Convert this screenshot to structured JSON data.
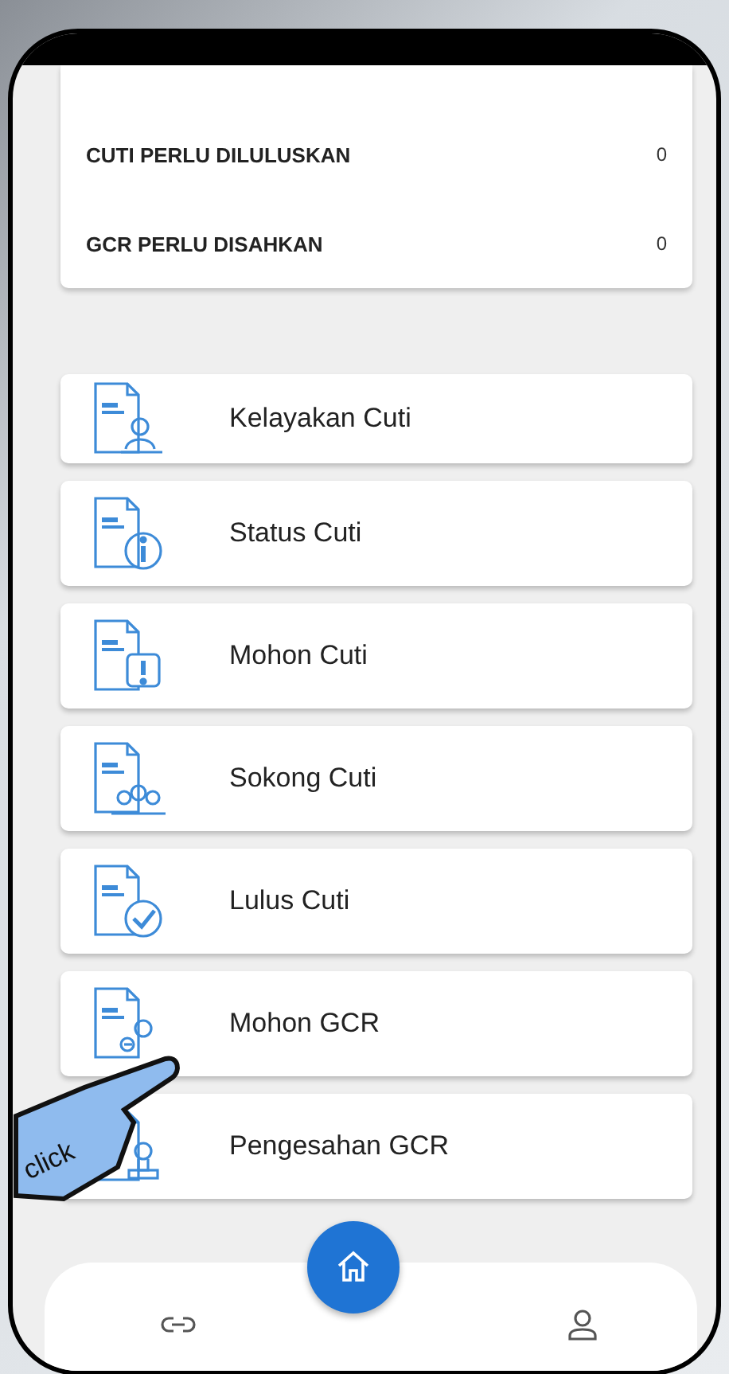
{
  "summary": [
    {
      "label": "CUTI PERLU DILULUSKAN",
      "count": "0"
    },
    {
      "label": "GCR PERLU DISAHKAN",
      "count": "0"
    }
  ],
  "menu": [
    {
      "label": "Kelayakan Cuti",
      "kind": "person"
    },
    {
      "label": "Status Cuti",
      "kind": "info"
    },
    {
      "label": "Mohon Cuti",
      "kind": "alert"
    },
    {
      "label": "Sokong Cuti",
      "kind": "group"
    },
    {
      "label": "Lulus Cuti",
      "kind": "check"
    },
    {
      "label": "Mohon GCR",
      "kind": "apply"
    },
    {
      "label": "Pengesahan GCR",
      "kind": "stamp"
    }
  ],
  "overlay": {
    "label": "click"
  }
}
